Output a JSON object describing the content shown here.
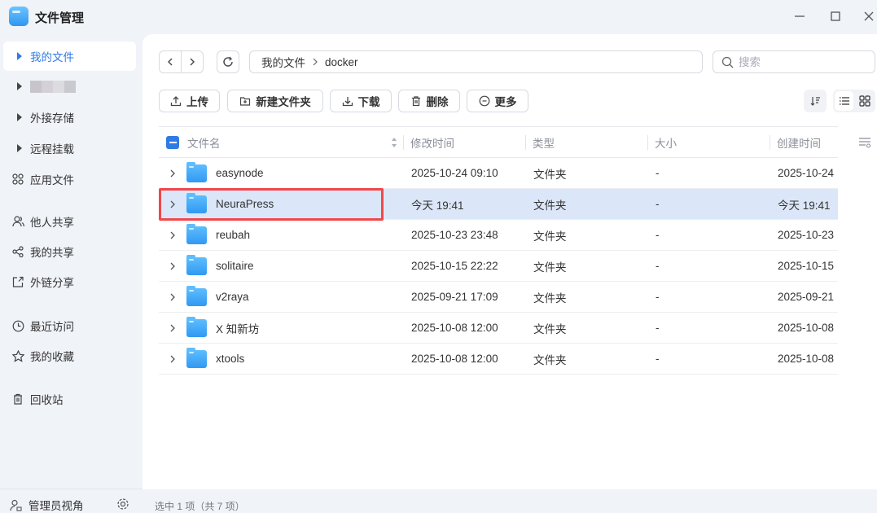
{
  "app": {
    "title": "文件管理"
  },
  "sidebar": {
    "items": [
      {
        "label": "我的文件",
        "icon": "triangle-right-icon",
        "active": true
      },
      {
        "label": "",
        "icon": "triangle-right-icon",
        "blurred": true
      },
      {
        "label": "外接存储",
        "icon": "triangle-right-icon"
      },
      {
        "label": "远程挂载",
        "icon": "triangle-right-icon"
      },
      {
        "label": "应用文件",
        "icon": "apps-icon"
      },
      {
        "label": "他人共享",
        "icon": "users-icon"
      },
      {
        "label": "我的共享",
        "icon": "share-icon"
      },
      {
        "label": "外链分享",
        "icon": "external-share-icon"
      },
      {
        "label": "最近访问",
        "icon": "clock-icon"
      },
      {
        "label": "我的收藏",
        "icon": "star-icon"
      },
      {
        "label": "回收站",
        "icon": "trash-icon"
      }
    ],
    "footer": {
      "label": "管理员视角"
    }
  },
  "breadcrumb": [
    "我的文件",
    "docker"
  ],
  "search": {
    "placeholder": "搜索"
  },
  "toolbar": {
    "upload": "上传",
    "new_folder": "新建文件夹",
    "download": "下载",
    "delete": "删除",
    "more": "更多"
  },
  "table": {
    "columns": [
      "文件名",
      "修改时间",
      "类型",
      "大小",
      "创建时间"
    ],
    "rows": [
      {
        "name": "easynode",
        "modified": "2025-10-24 09:10",
        "type": "文件夹",
        "size": "-",
        "created": "2025-10-24"
      },
      {
        "name": "NeuraPress",
        "modified": "今天 19:41",
        "type": "文件夹",
        "size": "-",
        "created": "今天 19:41",
        "selected": true
      },
      {
        "name": "reubah",
        "modified": "2025-10-23 23:48",
        "type": "文件夹",
        "size": "-",
        "created": "2025-10-23"
      },
      {
        "name": "solitaire",
        "modified": "2025-10-15 22:22",
        "type": "文件夹",
        "size": "-",
        "created": "2025-10-15"
      },
      {
        "name": "v2raya",
        "modified": "2025-09-21 17:09",
        "type": "文件夹",
        "size": "-",
        "created": "2025-09-21"
      },
      {
        "name": "X 知新坊",
        "modified": "2025-10-08 12:00",
        "type": "文件夹",
        "size": "-",
        "created": "2025-10-08"
      },
      {
        "name": "xtools",
        "modified": "2025-10-08 12:00",
        "type": "文件夹",
        "size": "-",
        "created": "2025-10-08"
      }
    ]
  },
  "status": {
    "text": "选中 1 项（共 7 项）"
  },
  "colors": {
    "accent": "#2f7be5",
    "selected_row": "#dbe7f8",
    "highlight": "#f0474a"
  }
}
